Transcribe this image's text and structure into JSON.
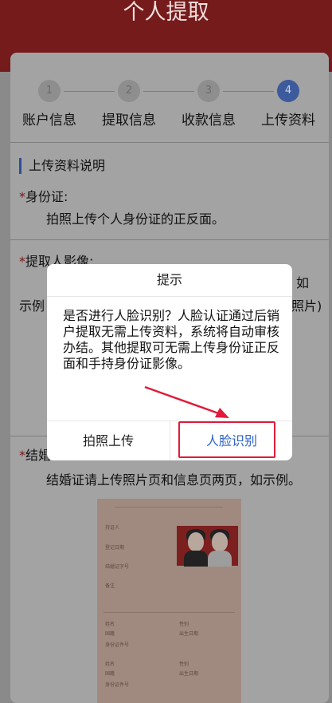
{
  "header": {
    "title": "个人提取"
  },
  "steps": [
    {
      "number": "1",
      "label": "账户信息"
    },
    {
      "number": "2",
      "label": "提取信息"
    },
    {
      "number": "3",
      "label": "收款信息"
    },
    {
      "number": "4",
      "label": "上传资料"
    }
  ],
  "section": {
    "title": "上传资料说明",
    "id_card": {
      "star": "*",
      "label": "身份证:",
      "desc": "拍照上传个人身份证的正反面。"
    },
    "photo": {
      "star": "*",
      "label": "提取人影像:",
      "partial_right": "如",
      "partial_left": "示例",
      "partial_right2": "照片)"
    },
    "marriage": {
      "star": "*",
      "label": "结婚证",
      "desc": "结婚证请上传照片页和信息页两页，如示例。"
    }
  },
  "sample_cert": {
    "fields_top": [
      "持证人",
      "登记日期",
      "结婚证字号",
      "备注"
    ],
    "fields_bottom_left": [
      "姓名",
      "国籍",
      "身份证件号"
    ],
    "fields_bottom_right": [
      "性别",
      "出生日期"
    ]
  },
  "dialog": {
    "title": "提示",
    "message": "是否进行人脸识别？人脸认证通过后销户提取无需上传资料，系统将自动审核办结。其他提取可无需上传身份证正反面和手持身份证影像。",
    "cancel_label": "拍照上传",
    "confirm_label": "人脸识别"
  },
  "colors": {
    "header": "#751b1b",
    "accent_blue": "#2d63c8",
    "highlight_red": "#e01c3a"
  }
}
